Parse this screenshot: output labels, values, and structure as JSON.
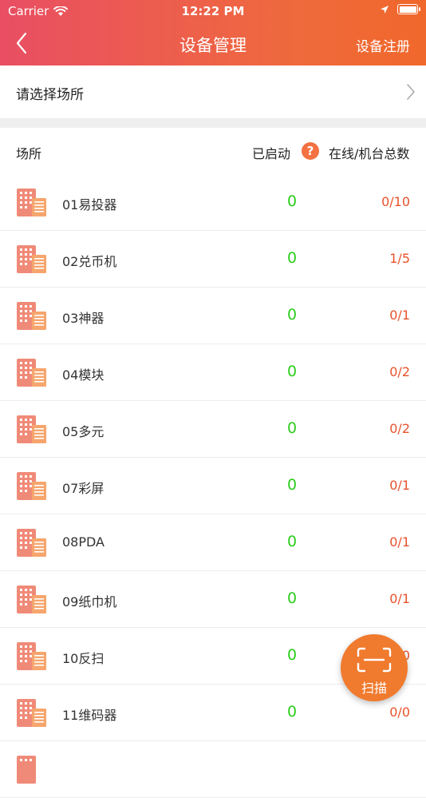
{
  "status_bar": {
    "carrier": "Carrier",
    "time": "12:22 PM"
  },
  "nav": {
    "title": "设备管理",
    "right_action": "设备注册",
    "back_icon": "chevron-left-icon"
  },
  "venue_select": {
    "label": "请选择场所",
    "icon": "chevron-right-icon"
  },
  "table_header": {
    "venue": "场所",
    "started": "已启动",
    "help": "?",
    "online_total": "在线/机台总数"
  },
  "rows": [
    {
      "name": "01易投器",
      "started": "0",
      "ratio": "0/10"
    },
    {
      "name": "02兑币机",
      "started": "0",
      "ratio": "1/5"
    },
    {
      "name": "03神器",
      "started": "0",
      "ratio": "0/1"
    },
    {
      "name": "04模块",
      "started": "0",
      "ratio": "0/2"
    },
    {
      "name": "05多元",
      "started": "0",
      "ratio": "0/2"
    },
    {
      "name": "07彩屏",
      "started": "0",
      "ratio": "0/1"
    },
    {
      "name": "08PDA",
      "started": "0",
      "ratio": "0/1"
    },
    {
      "name": "09纸巾机",
      "started": "0",
      "ratio": "0/1"
    },
    {
      "name": "10反扫",
      "started": "0",
      "ratio": "0/0"
    },
    {
      "name": "11维码器",
      "started": "0",
      "ratio": "0/0"
    },
    {
      "name": "",
      "started": "",
      "ratio": ""
    }
  ],
  "scan_button": {
    "label": "扫描",
    "icon": "scan-frame-icon"
  },
  "colors": {
    "header_start": "#e94e63",
    "header_end": "#f0682b",
    "started": "#2ecc1f",
    "ratio": "#e8522b",
    "scan": "#f07a2e"
  }
}
